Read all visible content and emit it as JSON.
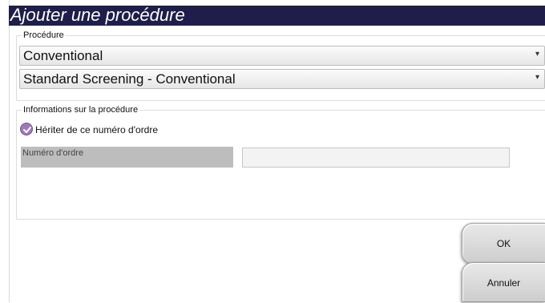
{
  "dialog": {
    "title": "Ajouter une procédure"
  },
  "procedure_group": {
    "legend": "Procédure",
    "select1": {
      "value": "Conventional"
    },
    "select2": {
      "value": "Standard Screening - Conventional"
    }
  },
  "info_group": {
    "legend": "Informations sur la procédure",
    "inherit_checkbox": {
      "label": "Hériter de ce numéro d'ordre",
      "checked": true
    },
    "order_number": {
      "label": "Numéro d'ordre",
      "value": ""
    }
  },
  "buttons": {
    "ok": "OK",
    "cancel": "Annuler"
  },
  "colors": {
    "titlebar": "#1f1e4a",
    "checkbox": "#a07ab8"
  }
}
